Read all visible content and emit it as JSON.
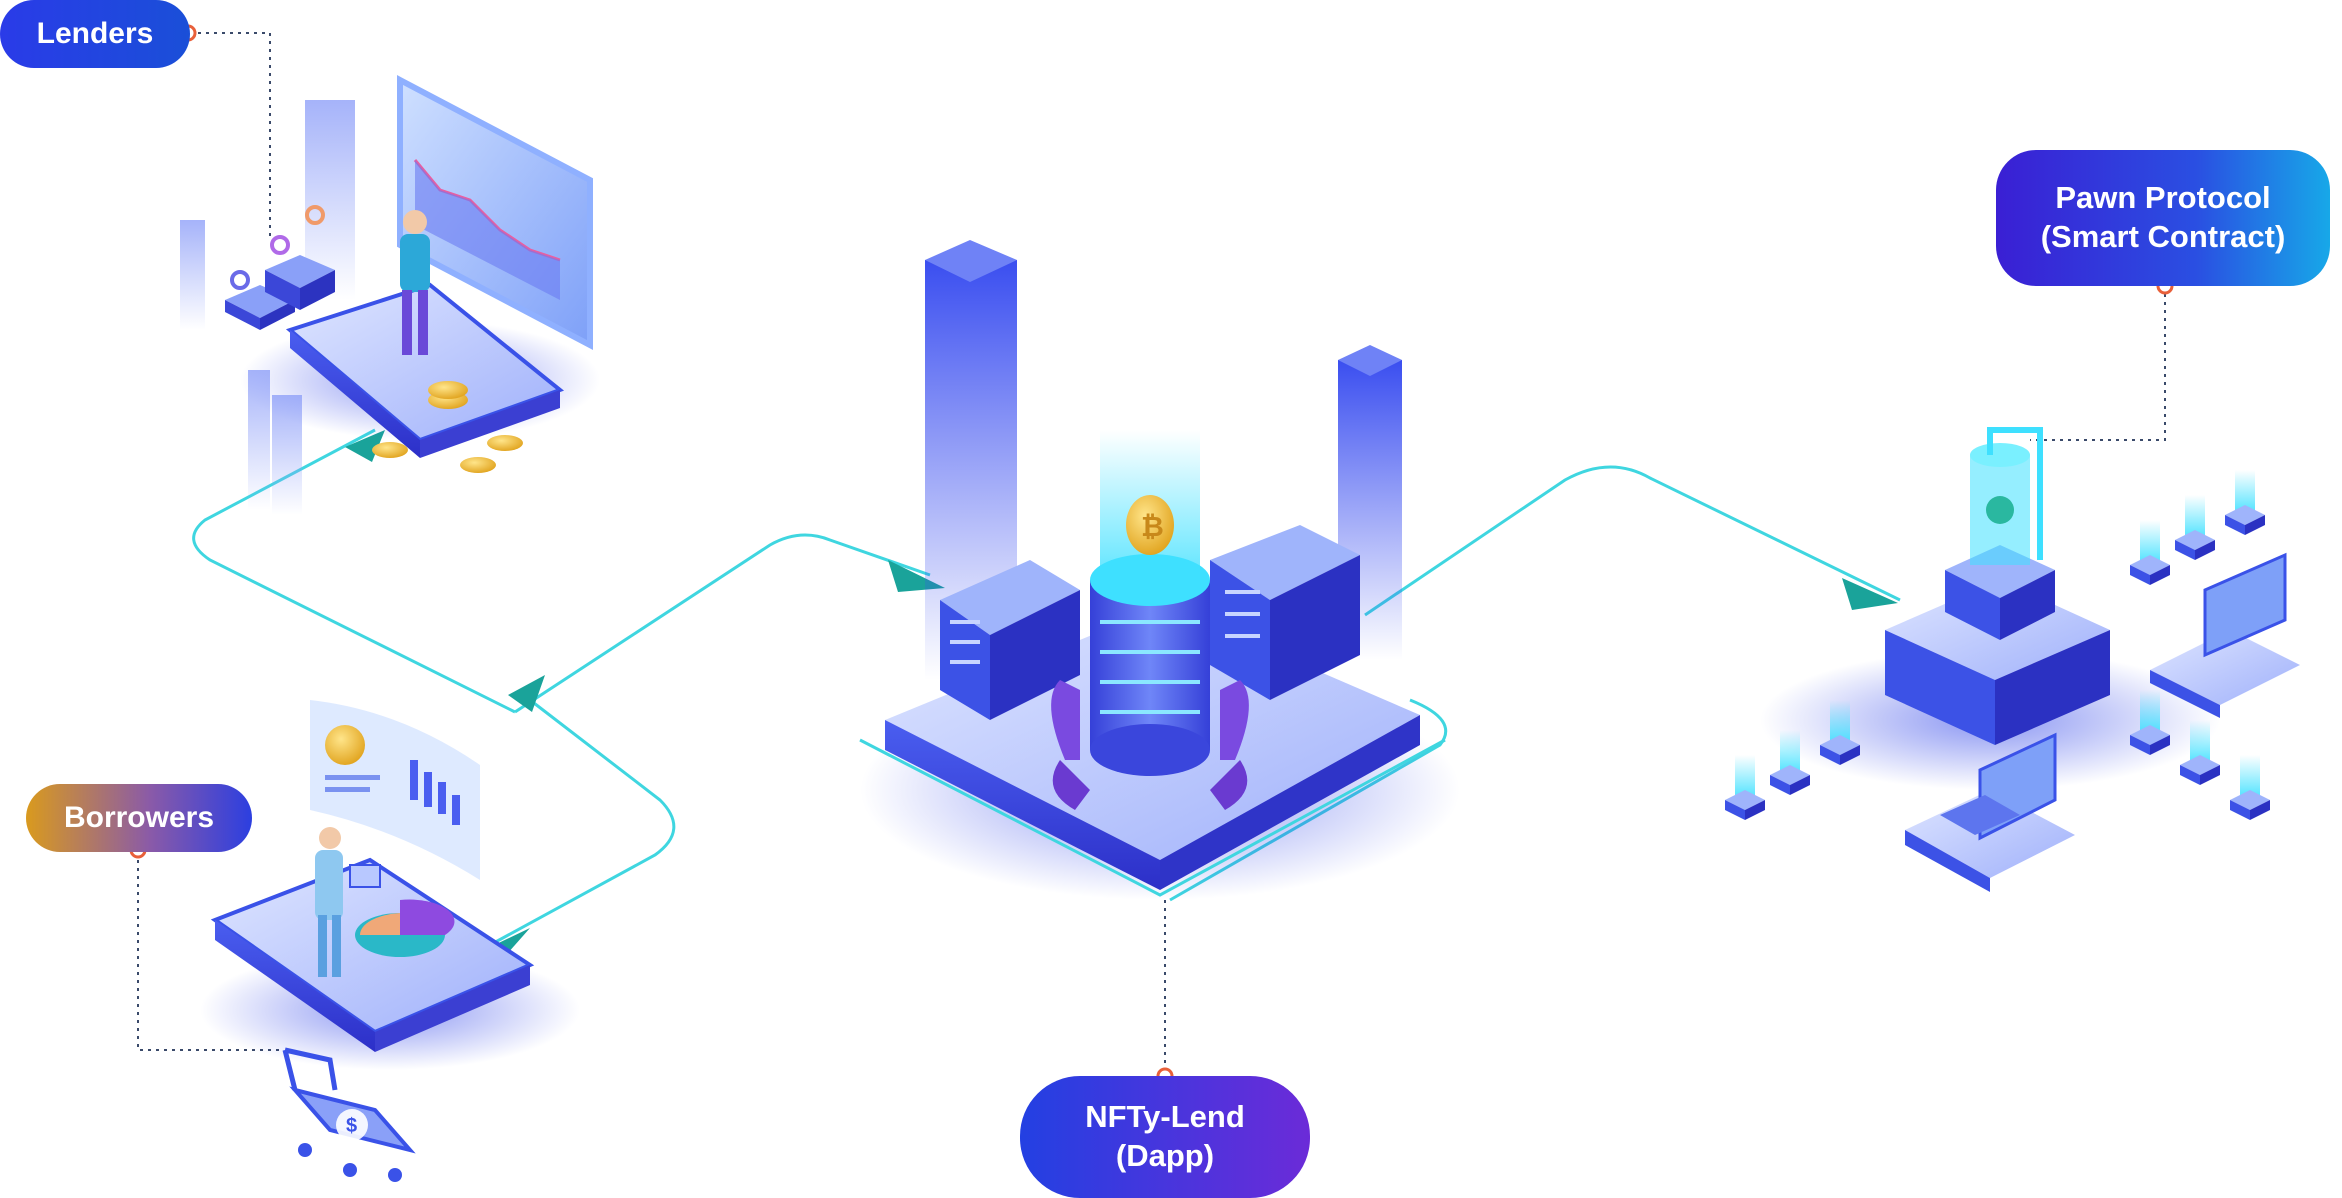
{
  "nodes": {
    "lenders": {
      "label": "Lenders",
      "color_from": "#2a3be8",
      "color_to": "#1a4fd8"
    },
    "borrowers": {
      "label": "Borrowers",
      "color_from": "#d99a1e",
      "color_to": "#2c3fe0"
    },
    "nfty_lend": {
      "line1": "NFTy-Lend",
      "line2": "(Dapp)",
      "color_from": "#2340e2",
      "color_to": "#6b2bd8"
    },
    "pawn_protocol": {
      "line1": "Pawn Protocol",
      "line2": "(Smart Contract)",
      "color_from": "#3a1fd4",
      "color_to": "#17a8e8"
    }
  },
  "icons": [
    "bitcoin-coin-icon",
    "server-rack-icon",
    "laptop-icon",
    "monitor-icon",
    "shopping-cart-icon",
    "person-icon",
    "dollar-icon"
  ],
  "colors": {
    "flow_line": "#3fd6e0",
    "arrow": "#1aa39a",
    "connector_dot": "#e8603a",
    "platform": "#4a6cf0"
  }
}
